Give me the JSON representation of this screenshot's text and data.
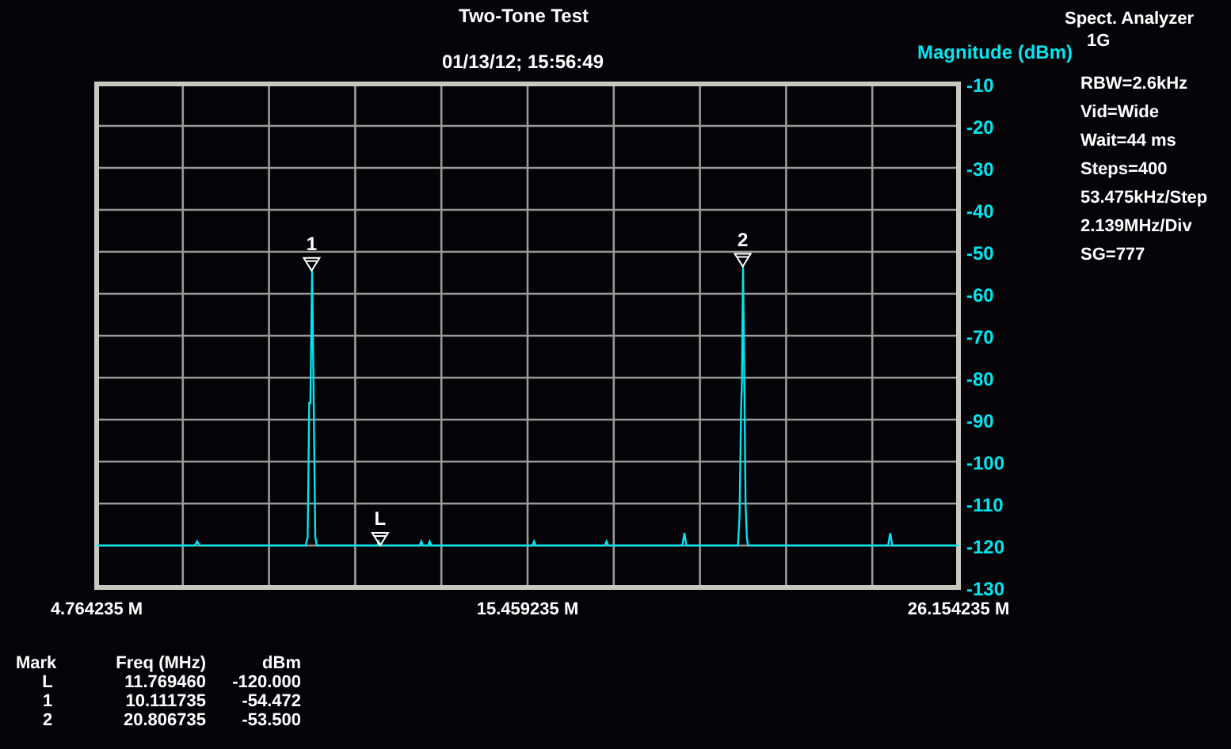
{
  "title": "Two-Tone Test",
  "timestamp": "01/13/12; 15:56:49",
  "chart_data": {
    "type": "line",
    "grid": true,
    "ylabel": "Magnitude (dBm)",
    "xlim": [
      4.764235,
      26.154235
    ],
    "ylim": [
      -130,
      -10
    ],
    "xticks": [
      {
        "value": 4.764235,
        "label": "4.764235 M"
      },
      {
        "value": 15.459235,
        "label": "15.459235 M"
      },
      {
        "value": 26.154235,
        "label": "26.154235 M"
      }
    ],
    "yticks": [
      -10,
      -20,
      -30,
      -40,
      -50,
      -60,
      -70,
      -80,
      -90,
      -100,
      -110,
      -120,
      -130
    ],
    "x": [
      4.764235,
      7.2,
      7.26,
      7.32,
      9.95,
      10.0,
      10.04,
      10.07,
      10.111735,
      10.15,
      10.19,
      10.23,
      11.73,
      11.77,
      11.81,
      12.78,
      12.82,
      12.86,
      12.99,
      13.03,
      13.07,
      15.58,
      15.62,
      15.66,
      17.38,
      17.42,
      17.46,
      19.3,
      19.35,
      19.4,
      20.68,
      20.72,
      20.76,
      20.78,
      20.806735,
      20.84,
      20.87,
      20.9,
      20.93,
      24.41,
      24.46,
      24.51,
      26.154235
    ],
    "series": [
      {
        "color": "#00e5ee",
        "values": [
          -120,
          -120,
          -119,
          -120,
          -120,
          -118,
          -86,
          -86,
          -54.5,
          -86,
          -118,
          -120,
          -120,
          -119,
          -120,
          -120,
          -119,
          -120,
          -120,
          -119,
          -120,
          -120,
          -119,
          -120,
          -120,
          -119,
          -120,
          -120,
          -117,
          -120,
          -120,
          -113,
          -87,
          -81,
          -53.5,
          -81,
          -110,
          -118,
          -120,
          -120,
          -117,
          -120,
          -120
        ]
      }
    ],
    "annotations": [
      {
        "x": 10.1,
        "y": -54.5,
        "text": "1"
      },
      {
        "x": 11.8,
        "y": -120,
        "text": "L"
      },
      {
        "x": 20.8,
        "y": -53.5,
        "text": "2"
      }
    ]
  },
  "analyzer": {
    "title": "Spect. Analyzer",
    "band": "1G",
    "settings": [
      "RBW=2.6kHz",
      "Vid=Wide",
      "Wait=44 ms",
      "Steps=400",
      "53.475kHz/Step",
      "2.139MHz/Div",
      "SG=777"
    ]
  },
  "markers": {
    "columns": [
      "Mark",
      "Freq (MHz)",
      "dBm"
    ],
    "rows": [
      [
        "L",
        "11.769460",
        "-120.000"
      ],
      [
        "1",
        "10.111735",
        "-54.472"
      ],
      [
        "2",
        "20.806735",
        "-53.500"
      ]
    ]
  }
}
